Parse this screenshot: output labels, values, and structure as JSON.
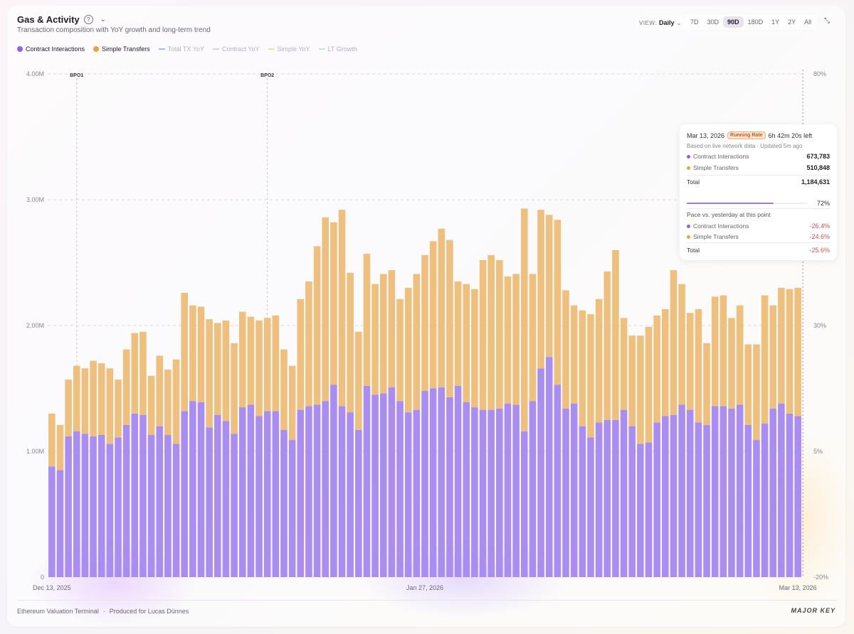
{
  "header": {
    "title": "Gas & Activity",
    "subtitle": "Transaction composition with YoY growth and long-term trend",
    "view_label": "VIEW:",
    "view_value": "Daily",
    "ranges": [
      "7D",
      "30D",
      "90D",
      "180D",
      "1Y",
      "2Y",
      "All"
    ],
    "active_range": "90D"
  },
  "legend": [
    {
      "label": "Contract Interactions",
      "color": "#8b63ee",
      "kind": "dot",
      "dim": false
    },
    {
      "label": "Simple Transfers",
      "color": "#e8a43f",
      "kind": "dot",
      "dim": false
    },
    {
      "label": "Total TX YoY",
      "color": "#aab6f2",
      "kind": "line",
      "dim": true
    },
    {
      "label": "Contract YoY",
      "color": "#d9cdf6",
      "kind": "line",
      "dim": true
    },
    {
      "label": "Simple YoY",
      "color": "#f4dcb6",
      "kind": "line",
      "dim": true
    },
    {
      "label": "LT Growth",
      "color": "#c9e3cf",
      "kind": "line",
      "dim": true
    }
  ],
  "tooltip": {
    "date": "Mar 13, 2026",
    "badge": "Running Rate",
    "time_left": "6h 42m 20s left",
    "subline": "Based on live network data · Updated 5m ago",
    "rows": [
      {
        "label": "Contract Interactions",
        "value": "673,783",
        "color": "#8b63ee"
      },
      {
        "label": "Simple Transfers",
        "value": "510,848",
        "color": "#e8a43f"
      }
    ],
    "total_label": "Total",
    "total_value": "1,184,631",
    "progress": 0.72,
    "progress_label": "72%",
    "pace_title": "Pace vs. yesterday at this point",
    "pace_rows": [
      {
        "label": "Contract Interactions",
        "value": "-26.4%",
        "color": "#8b63ee"
      },
      {
        "label": "Simple Transfers",
        "value": "-24.6%",
        "color": "#e8a43f"
      }
    ],
    "pace_total_label": "Total",
    "pace_total_value": "-25.6%"
  },
  "footer": {
    "left": "Ethereum Valuation Terminal",
    "sep": "·",
    "credit": "Produced for Lucas Dünnes",
    "brand": "MAJOR KEY"
  },
  "chart_data": {
    "type": "bar",
    "stacked": true,
    "y_left_ticks": [
      "0",
      "1.00M",
      "2.00M",
      "3.00M",
      "4.00M"
    ],
    "ylim": [
      0,
      4000000
    ],
    "y_right_ticks": [
      "-20%",
      "5%",
      "30%",
      "55%",
      "80%"
    ],
    "y_right_lim": [
      -20,
      80
    ],
    "x_tick_labels": [
      {
        "label": "Dec 13, 2025",
        "index": 0
      },
      {
        "label": "Jan 27, 2026",
        "index": 45
      },
      {
        "label": "Mar 13, 2026",
        "index": 90
      }
    ],
    "annotations": [
      {
        "label": "BPO1",
        "index": 3
      },
      {
        "label": "BPO2",
        "index": 26
      }
    ],
    "grid": true,
    "series": [
      {
        "name": "Contract Interactions",
        "color": "#a98df3",
        "values": [
          880000,
          850000,
          1120000,
          1160000,
          1140000,
          1120000,
          1130000,
          1060000,
          1110000,
          1210000,
          1300000,
          1290000,
          1130000,
          1200000,
          1130000,
          1060000,
          1320000,
          1400000,
          1390000,
          1190000,
          1290000,
          1240000,
          1140000,
          1350000,
          1370000,
          1280000,
          1320000,
          1320000,
          1170000,
          1090000,
          1330000,
          1360000,
          1370000,
          1400000,
          1530000,
          1360000,
          1310000,
          1170000,
          1520000,
          1450000,
          1460000,
          1510000,
          1400000,
          1310000,
          1330000,
          1480000,
          1500000,
          1510000,
          1430000,
          1520000,
          1390000,
          1350000,
          1330000,
          1330000,
          1340000,
          1380000,
          1370000,
          1160000,
          1400000,
          1660000,
          1750000,
          1530000,
          1340000,
          1380000,
          1200000,
          1110000,
          1230000,
          1250000,
          1250000,
          1330000,
          1200000,
          1060000,
          1070000,
          1230000,
          1280000,
          1290000,
          1370000,
          1330000,
          1230000,
          1210000,
          1360000,
          1360000,
          1340000,
          1370000,
          1210000,
          1090000,
          1220000,
          1340000,
          1380000,
          1300000,
          1280000
        ]
      },
      {
        "name": "Simple Transfers",
        "color": "#efbf7e",
        "values": [
          420000,
          360000,
          450000,
          520000,
          520000,
          600000,
          570000,
          600000,
          460000,
          600000,
          640000,
          660000,
          470000,
          560000,
          520000,
          670000,
          940000,
          760000,
          760000,
          860000,
          730000,
          800000,
          720000,
          760000,
          700000,
          760000,
          740000,
          760000,
          640000,
          590000,
          880000,
          990000,
          1260000,
          1460000,
          1290000,
          1560000,
          1110000,
          780000,
          1050000,
          880000,
          950000,
          930000,
          810000,
          990000,
          1080000,
          1080000,
          1170000,
          1260000,
          1250000,
          830000,
          940000,
          940000,
          1190000,
          1230000,
          1180000,
          1010000,
          1040000,
          1770000,
          1010000,
          1260000,
          1130000,
          1310000,
          940000,
          780000,
          920000,
          980000,
          980000,
          1180000,
          1350000,
          730000,
          720000,
          860000,
          920000,
          850000,
          850000,
          1150000,
          960000,
          770000,
          900000,
          650000,
          870000,
          880000,
          720000,
          790000,
          640000,
          760000,
          1020000,
          820000,
          920000,
          990000,
          1020000
        ]
      }
    ]
  }
}
